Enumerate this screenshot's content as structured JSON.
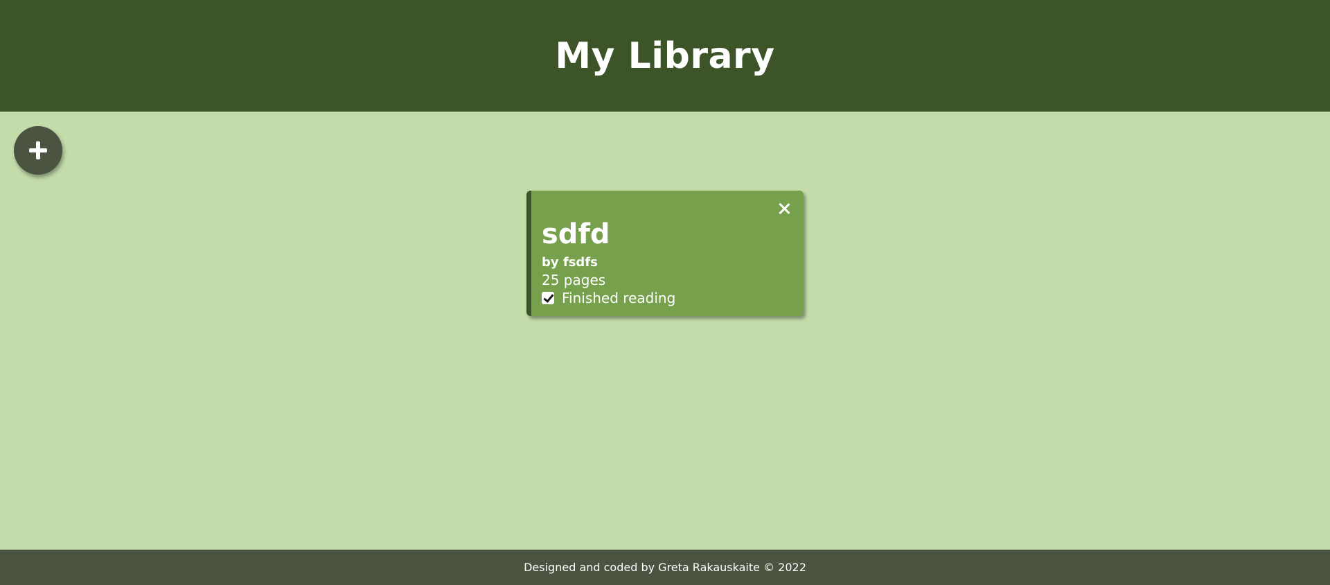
{
  "header": {
    "title": "My Library"
  },
  "add_button": {
    "icon": "plus-icon"
  },
  "books": [
    {
      "title": "sdfd",
      "author_line": "by fsdfs",
      "pages_line": "25 pages",
      "read_label": "Finished reading",
      "finished": true,
      "close_icon": "close-icon"
    }
  ],
  "footer": {
    "text": "Designed and coded by Greta Rakauskaite © 2022"
  },
  "colors": {
    "header_bg": "#3d5428",
    "page_bg": "#c4dcaa",
    "card_bg": "#76a04b",
    "card_accent": "#3d5428",
    "button_bg": "#4b5341",
    "footer_bg": "#4b5341",
    "text": "#ffffff"
  }
}
